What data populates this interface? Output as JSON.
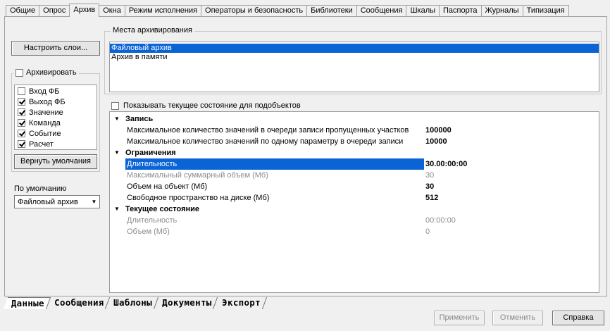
{
  "top_tabs": [
    "Общие",
    "Опрос",
    "Архив",
    "Окна",
    "Режим исполнения",
    "Операторы и безопасность",
    "Библиотеки",
    "Сообщения",
    "Шкалы",
    "Паспорта",
    "Журналы",
    "Типизация"
  ],
  "active_top_tab": "Архив",
  "left": {
    "setup_layers_label": "Настроить слои...",
    "archive_checkbox_label": "Архивировать",
    "archive_items": [
      {
        "label": "Вход ФБ",
        "checked": false
      },
      {
        "label": "Выход ФБ",
        "checked": true
      },
      {
        "label": "Значение",
        "checked": true
      },
      {
        "label": "Команда",
        "checked": true
      },
      {
        "label": "Событие",
        "checked": true
      },
      {
        "label": "Расчет",
        "checked": true
      }
    ],
    "restore_defaults_label": "Вернуть умолчания",
    "default_label": "По умолчанию",
    "default_value": "Файловый архив"
  },
  "places": {
    "title": "Места архивирования",
    "items": [
      {
        "label": "Файловый архив",
        "selected": true
      },
      {
        "label": "Архив в памяти",
        "selected": false
      }
    ]
  },
  "show_state_label": "Показывать текущее состояние для подобъектов",
  "grid": {
    "categories": [
      {
        "name": "Запись",
        "rows": [
          {
            "name": "Максимальное количество значений в очереди записи пропущенных участков",
            "value": "100000",
            "disabled": false,
            "selected": false
          },
          {
            "name": "Максимальное количество значений по одному параметру в очереди записи",
            "value": "10000",
            "disabled": false,
            "selected": false
          }
        ]
      },
      {
        "name": "Ограничения",
        "rows": [
          {
            "name": "Длительность",
            "value": "30.00:00:00",
            "disabled": false,
            "selected": true
          },
          {
            "name": "Максимальный суммарный объем (Мб)",
            "value": "30",
            "disabled": true,
            "selected": false
          },
          {
            "name": "Объем на объект (Мб)",
            "value": "30",
            "disabled": false,
            "selected": false
          },
          {
            "name": "Свободное пространство на диске (Мб)",
            "value": "512",
            "disabled": false,
            "selected": false
          }
        ]
      },
      {
        "name": "Текущее состояние",
        "rows": [
          {
            "name": "Длительность",
            "value": "00:00:00",
            "disabled": true,
            "selected": false
          },
          {
            "name": "Объем (Мб)",
            "value": "0",
            "disabled": true,
            "selected": false
          }
        ]
      }
    ]
  },
  "bottom_tabs": [
    "Данные",
    "Сообщения",
    "Шаблоны",
    "Документы",
    "Экспорт"
  ],
  "active_bottom_tab": "Данные",
  "footer": {
    "apply_label": "Применить",
    "cancel_label": "Отменить",
    "help_label": "Справка"
  },
  "icons": {
    "dropdown": "chevron-down-icon",
    "expand": "triangle-down-icon"
  }
}
